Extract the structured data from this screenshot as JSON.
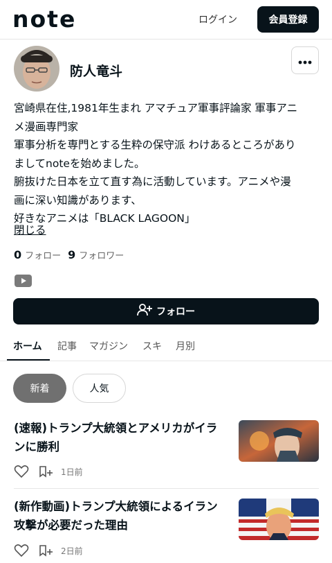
{
  "header": {
    "logo": "note",
    "login_label": "ログイン",
    "register_label": "会員登録"
  },
  "profile": {
    "name": "防人竜斗",
    "bio_lines": [
      "宮崎県在住,1981年生まれ アマチュア軍事評論家 軍事アニ",
      "メ漫画専門家",
      "軍事分析を専門とする生粋の保守派 わけあるところがあり",
      "ましてnoteを始めました。",
      "腑抜けた日本を立て直す為に活動しています。アニメや漫",
      "画に深い知識があります、",
      "好きなアニメは「BLACK LAGOON」"
    ],
    "collapse_label": "閉じる",
    "following_count": "0",
    "following_label": "フォロー",
    "followers_count": "9",
    "followers_label": "フォロワー",
    "follow_button_label": "フォロー"
  },
  "tabs": [
    {
      "label": "ホーム"
    },
    {
      "label": "記事"
    },
    {
      "label": "マガジン"
    },
    {
      "label": "スキ"
    },
    {
      "label": "月別"
    }
  ],
  "filters": {
    "new_label": "新着",
    "popular_label": "人気"
  },
  "articles": [
    {
      "title_line1": "(速報)トランプ大統領とアメリカがイラ",
      "title_line2": "ン",
      "title_line2_full": "ンに勝利",
      "date": "1日前"
    },
    {
      "title_line1": "(新作動画)トランプ大統領によるイラン",
      "title_line2_full": "攻撃が必要だった理由",
      "date": "2日前"
    }
  ],
  "colors": {
    "primary": "#08131a",
    "chip_active": "#707070",
    "divider": "#e6e6e6"
  }
}
